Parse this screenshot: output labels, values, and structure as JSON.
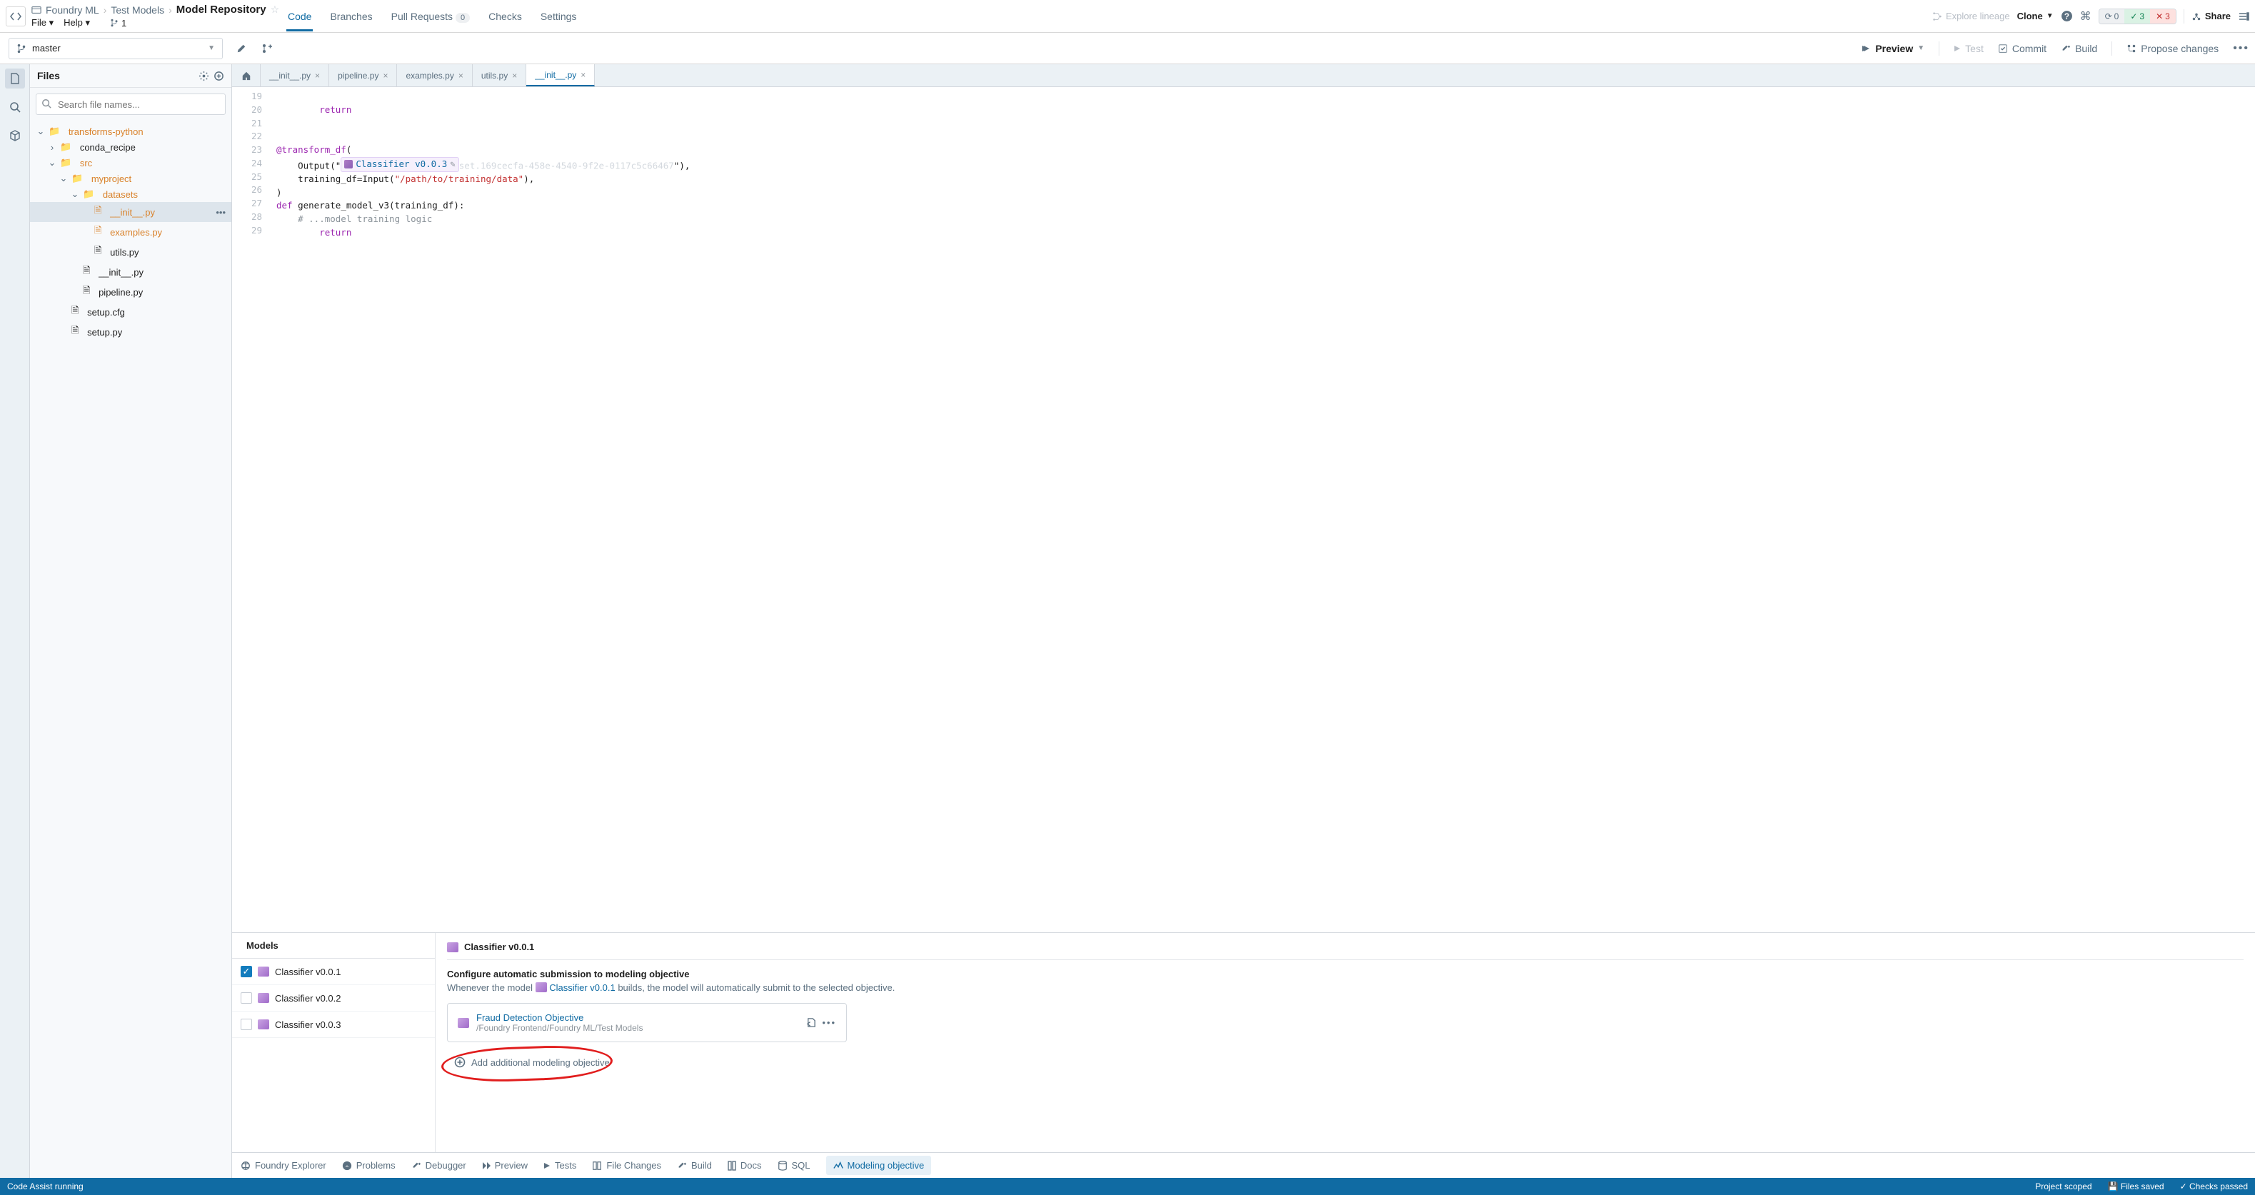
{
  "breadcrumb": {
    "workspace": "Foundry ML",
    "project": "Test Models",
    "repo": "Model Repository"
  },
  "menus": {
    "file": "File",
    "help": "Help",
    "branchCount": "1"
  },
  "mainTabs": {
    "code": "Code",
    "branches": "Branches",
    "pulls": "Pull Requests",
    "pullsCount": "0",
    "checks": "Checks",
    "settings": "Settings"
  },
  "top": {
    "explore": "Explore lineage",
    "clone": "Clone",
    "sync": "0",
    "pass": "3",
    "fail": "3",
    "share": "Share"
  },
  "branch": "master",
  "toolbar": {
    "preview": "Preview",
    "test": "Test",
    "commit": "Commit",
    "build": "Build",
    "propose": "Propose changes"
  },
  "files": {
    "title": "Files",
    "searchPh": "Search file names..."
  },
  "tree": {
    "root": "transforms-python",
    "conda": "conda_recipe",
    "src": "src",
    "myproject": "myproject",
    "datasets": "datasets",
    "initds": "__init__.py",
    "examples": "examples.py",
    "utils": "utils.py",
    "initproj": "__init__.py",
    "pipeline": "pipeline.py",
    "setupcfg": "setup.cfg",
    "setuppy": "setup.py"
  },
  "etabs": {
    "t1": "__init__.py",
    "t2": "pipeline.py",
    "t3": "examples.py",
    "t4": "utils.py",
    "t5": "__init__.py"
  },
  "code": {
    "l19": "        return",
    "l22": "@transform_df(",
    "l23a": "    Output(\"",
    "chip": "Classifier v0.0.3",
    "l23ghost": "set.169cecfa-458e-4540-9f2e-0117c5c66467",
    "l23b": "\"),",
    "l24a": "    training_df=Input(",
    "l24str": "\"/path/to/training/data\"",
    "l24b": "),",
    "l25": ")",
    "l26a": "def ",
    "l26b": "generate_model_v3(training_df):",
    "l27": "    # ...model training logic",
    "l28": "        return"
  },
  "lines": [
    "19",
    "20",
    "21",
    "22",
    "23",
    "24",
    "25",
    "26",
    "27",
    "28",
    "29"
  ],
  "models": {
    "header": "Models",
    "m1": "Classifier v0.0.1",
    "m2": "Classifier v0.0.2",
    "m3": "Classifier v0.0.3"
  },
  "detail": {
    "title": "Classifier v0.0.1",
    "confHead": "Configure automatic submission to modeling objective",
    "subA": "Whenever the model ",
    "subModel": "Classifier v0.0.1",
    "subB": " builds, the model will automatically submit to the selected objective.",
    "objName": "Fraud Detection Objective",
    "objPath": "/Foundry Frontend/Foundry ML/Test Models",
    "addObj": "Add additional modeling objective"
  },
  "bt": {
    "explorer": "Foundry Explorer",
    "problems": "Problems",
    "debugger": "Debugger",
    "preview": "Preview",
    "tests": "Tests",
    "changes": "File Changes",
    "build": "Build",
    "docs": "Docs",
    "sql": "SQL",
    "modeling": "Modeling objective"
  },
  "status": {
    "assist": "Code Assist running",
    "scope": "Project scoped",
    "saved": "Files saved",
    "checks": "Checks passed"
  }
}
